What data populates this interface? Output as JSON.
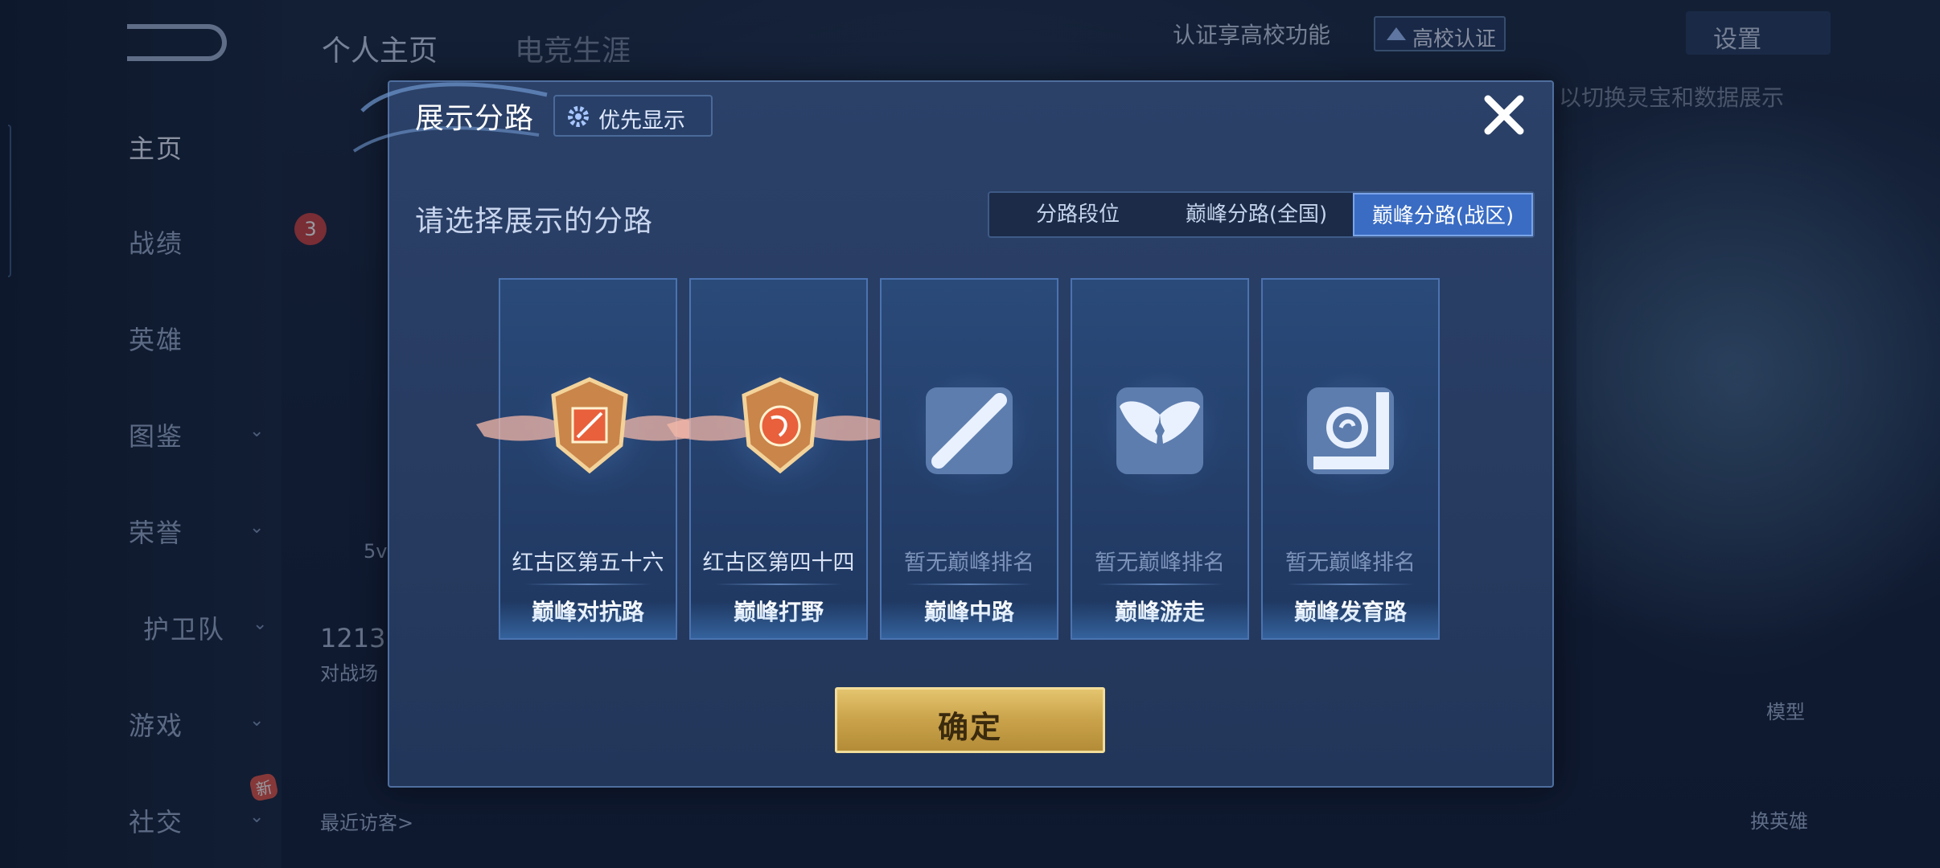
{
  "sidebar": {
    "items": [
      {
        "label": "主页",
        "has_chevron": false
      },
      {
        "label": "战绩",
        "has_chevron": false
      },
      {
        "label": "英雄",
        "has_chevron": false
      },
      {
        "label": "图鉴",
        "has_chevron": true
      },
      {
        "label": "荣誉",
        "has_chevron": true
      },
      {
        "label": "护卫队",
        "has_chevron": true
      },
      {
        "label": "游戏",
        "has_chevron": true
      },
      {
        "label": "社交",
        "has_chevron": true
      }
    ],
    "new_badge": "新"
  },
  "top_tabs": {
    "personal": "个人主页",
    "esports": "电竞生涯"
  },
  "top_right": {
    "campus_text": "认证享高校功能",
    "campus_button": "高校认证",
    "settings": "设置",
    "hint": "以切换灵宝和数据展示"
  },
  "background": {
    "visitors": "最近访客>",
    "count": "1213",
    "count_label": "对战场",
    "model": "模型",
    "change_hero": "换英雄",
    "level": "3",
    "small": "5v"
  },
  "modal": {
    "title": "展示分路",
    "priority_button": "优先显示",
    "subtitle": "请选择展示的分路",
    "segments": [
      "分路段位",
      "巅峰分路(全国)",
      "巅峰分路(战区)"
    ],
    "active_segment": 2,
    "cards": [
      {
        "rank": "红古区第五十六",
        "lane": "巅峰对抗路",
        "ranked": true,
        "icon": "clash-lane-badge-icon"
      },
      {
        "rank": "红古区第四十四",
        "lane": "巅峰打野",
        "ranked": true,
        "icon": "jungle-badge-icon"
      },
      {
        "rank": "暂无巅峰排名",
        "lane": "巅峰中路",
        "ranked": false,
        "icon": "mid-lane-icon"
      },
      {
        "rank": "暂无巅峰排名",
        "lane": "巅峰游走",
        "ranked": false,
        "icon": "roam-icon"
      },
      {
        "rank": "暂无巅峰排名",
        "lane": "巅峰发育路",
        "ranked": false,
        "icon": "farm-lane-icon"
      }
    ],
    "confirm": "确定"
  },
  "colors": {
    "accent": "#3a6cc4",
    "gold": "#c9a24a",
    "panel": "#283c62"
  }
}
